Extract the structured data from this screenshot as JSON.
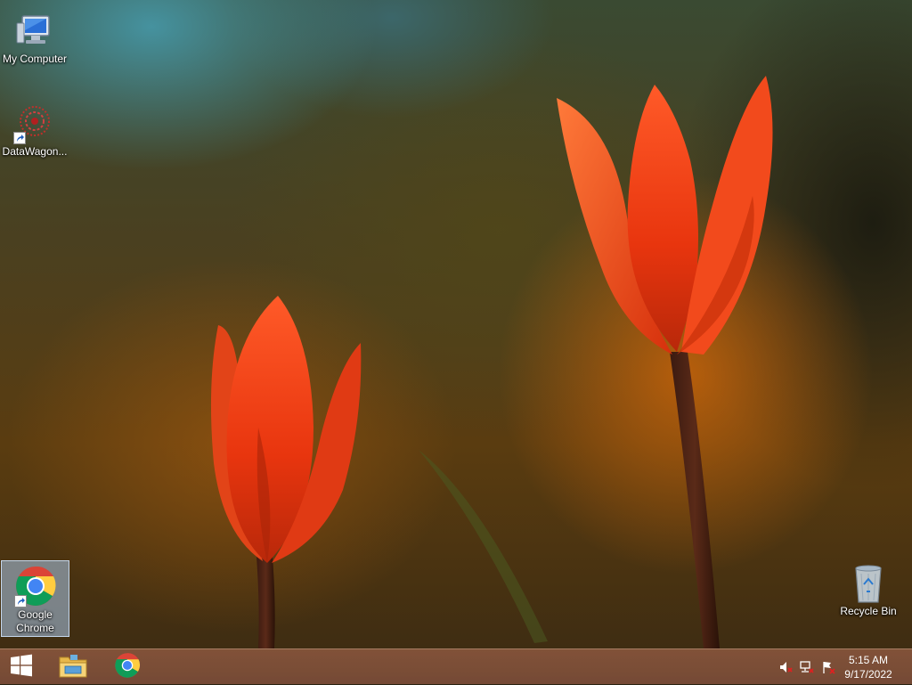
{
  "desktop": {
    "icons": [
      {
        "label": "My Computer",
        "icon": "computer-icon"
      },
      {
        "label": "DataWagon...",
        "icon": "datawagon-icon"
      },
      {
        "label": "Google Chrome",
        "icon": "chrome-icon"
      },
      {
        "label": "Recycle Bin",
        "icon": "recycle-bin-icon"
      }
    ]
  },
  "taskbar": {
    "buttons": [
      {
        "name": "Start",
        "icon": "windows-logo-icon"
      },
      {
        "name": "File Explorer",
        "icon": "folder-icon"
      },
      {
        "name": "Google Chrome",
        "icon": "chrome-icon"
      }
    ],
    "tray": {
      "icons": [
        "speaker-muted-icon",
        "network-icon",
        "action-center-flag-icon"
      ],
      "time": "5:15 AM",
      "date": "9/17/2022"
    }
  },
  "colors": {
    "taskbar": "#7e4f3a",
    "tulip": "#f0401a",
    "selection": "#aac8eb"
  }
}
